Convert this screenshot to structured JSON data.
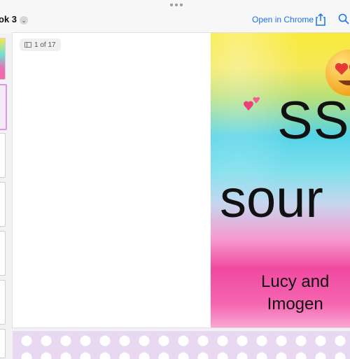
{
  "toolbar": {
    "doc_title": "ok 3",
    "open_in_chrome": "Open in Chrome",
    "icons": [
      "more-dots-icon",
      "chevron-down-icon",
      "share-icon",
      "search-icon"
    ],
    "link_color": "#1a73e8"
  },
  "page_indicator": {
    "label": "1 of 17",
    "current": 1,
    "total": 17
  },
  "cover": {
    "title_line1": "SS",
    "title_line2": "sour",
    "authors_line1": "Lucy and",
    "authors_line2": "Imogen",
    "decorations": [
      "heart-eyes-emoji",
      "two-hearts-emoji"
    ]
  }
}
